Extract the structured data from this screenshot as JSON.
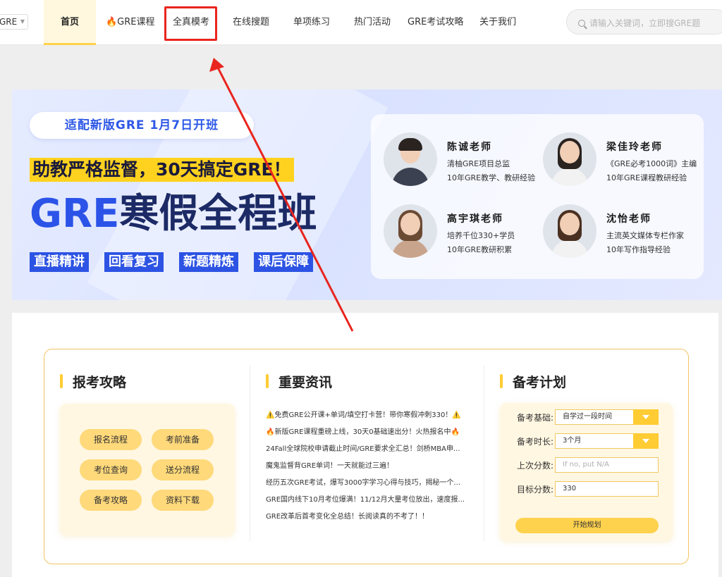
{
  "nav": {
    "lang": "GRE",
    "items": [
      "首页",
      "🔥GRE课程",
      "全真模考",
      "在线搜题",
      "单项练习",
      "热门活动",
      "GRE考试攻略",
      "关于我们"
    ],
    "search_placeholder": "请输入关键词，立即搜GRE题"
  },
  "banner": {
    "tagline": "适配新版GRE  1月7日开班",
    "slogan": "助教严格监督，30天搞定GRE！",
    "title_accent": "GRE",
    "title_rest": "寒假全程班",
    "tags": [
      "直播精讲",
      "回看复习",
      "新题精炼",
      "课后保障"
    ],
    "teachers": [
      {
        "name": "陈诚老师",
        "desc1": "清柚GRE项目总监",
        "desc2": "10年GRE教学、教研经验"
      },
      {
        "name": "梁佳玲老师",
        "desc1": "《GRE必考1000词》主编",
        "desc2": "10年GRE课程教研经验"
      },
      {
        "name": "高宇琪老师",
        "desc1": "培养千位330+学员",
        "desc2": "10年GRE教研积累"
      },
      {
        "name": "沈怡老师",
        "desc1": "主流英文媒体专栏作家",
        "desc2": "10年写作指导经验"
      }
    ]
  },
  "guide": {
    "title": "报考攻略",
    "buttons": [
      "报名流程",
      "考前准备",
      "考位查询",
      "送分流程",
      "备考攻略",
      "资料下载"
    ]
  },
  "news": {
    "title": "重要资讯",
    "items": [
      "⚠️免费GRE公开课+单词/填空打卡营！带你寒假冲刺330！⚠️",
      "🔥新版GRE课程重磅上线，30天0基础速出分！火热报名中🔥",
      "24Fall全球院校申请截止时间/GRE要求全汇总！剑桥MBA申...",
      "魔鬼监督背GRE单词！一天就能过三遍！",
      "经历五次GRE考试，爆写3000字学习心得与技巧，揭秘一个...",
      "GRE国内线下10月考位爆满！11/12月大量考位放出，速度报...",
      "GRE改革后首考变化全总结！长阅读真的不考了！！"
    ]
  },
  "plan": {
    "title": "备考计划",
    "base_label": "备考基础:",
    "base_value": "自学过一段时间",
    "duration_label": "备考时长:",
    "duration_value": "3个月",
    "last_label": "上次分数:",
    "last_placeholder": "If no, put N/A",
    "target_label": "目标分数:",
    "target_value": "330",
    "submit": "开始规划"
  }
}
